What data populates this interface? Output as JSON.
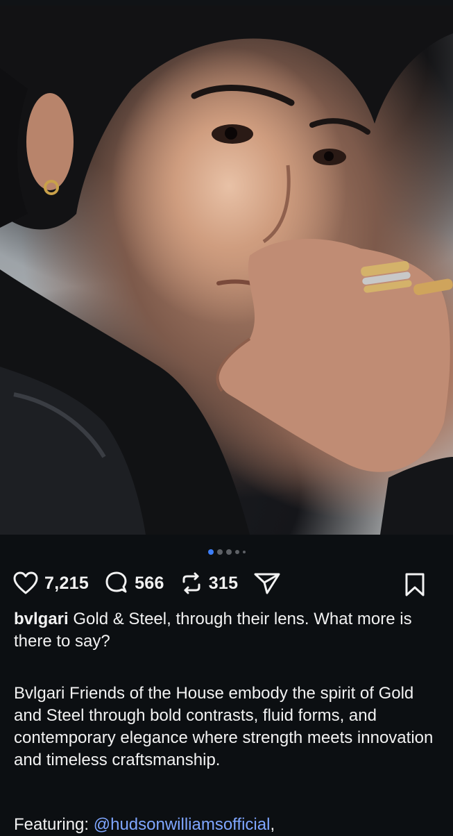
{
  "post": {
    "photo_alt_icon": "portrait-photo",
    "carousel_dots": 5,
    "carousel_active_index": 0
  },
  "actions": {
    "likes": "7,215",
    "comments": "566",
    "reposts": "315"
  },
  "caption": {
    "username": "bvlgari",
    "text": " Gold & Steel, through their lens. What more is there to say?"
  },
  "description": "Bvlgari Friends of the House embody the spirit of Gold and Steel through bold contrasts, fluid forms, and contemporary elegance where strength meets innovation and timeless craftsmanship.",
  "featuring": {
    "label": "Featuring: ",
    "mention": "@hudsonwilliamsofficial",
    "trail": ","
  },
  "colors": {
    "background": "#0c0f12",
    "accent": "#3d7ef7",
    "mention": "#7fa6ff"
  }
}
